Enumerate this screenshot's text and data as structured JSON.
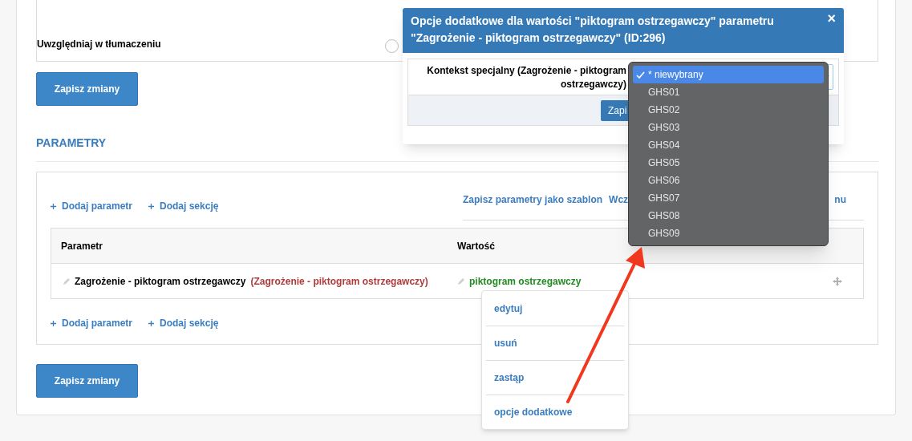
{
  "translation": {
    "label": "Uwzględniaj w tłumaczeniu",
    "radio_checked": false
  },
  "save_button_top": "Zapisz zmiany",
  "section_title": "PARAMETRY",
  "actions_top": [
    "Dodaj parametr",
    "Dodaj sekcję"
  ],
  "template_links": [
    "Zapisz parametry jako szablon",
    "Wcz",
    "nu"
  ],
  "table": {
    "columns": [
      "Parametr",
      "Wartość"
    ],
    "rows": [
      {
        "parameter": "Zagrożenie - piktogram ostrzegawczy",
        "parameter_note": "(Zagrożenie - piktogram ostrzegawczy)",
        "value": "piktogram ostrzegawczy"
      }
    ]
  },
  "actions_bottom": [
    "Dodaj parametr",
    "Dodaj sekcję"
  ],
  "save_button_bottom": "Zapisz zmiany",
  "context_menu": [
    "edytuj",
    "usuń",
    "zastąp",
    "opcje dodatkowe"
  ],
  "modal": {
    "title": "Opcje dodatkowe dla wartości \"piktogram ostrzegawczy\" parametru \"Zagrożenie - piktogram ostrzegawczy\" (ID:296)",
    "close": "×",
    "field_label": "Kontekst specjalny (Zagrożenie - piktogram ostrzegawczy)",
    "save": "Zapi"
  },
  "dropdown": [
    {
      "label": "* niewybrany",
      "selected": true
    },
    {
      "label": "GHS01",
      "selected": false
    },
    {
      "label": "GHS02",
      "selected": false
    },
    {
      "label": "GHS03",
      "selected": false
    },
    {
      "label": "GHS04",
      "selected": false
    },
    {
      "label": "GHS05",
      "selected": false
    },
    {
      "label": "GHS06",
      "selected": false
    },
    {
      "label": "GHS07",
      "selected": false
    },
    {
      "label": "GHS08",
      "selected": false
    },
    {
      "label": "GHS09",
      "selected": false
    }
  ]
}
